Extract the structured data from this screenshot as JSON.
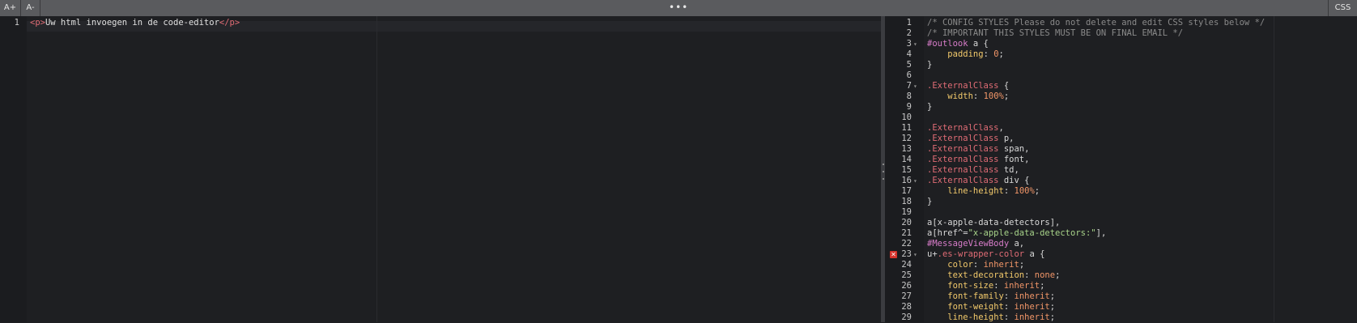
{
  "toolbar": {
    "increase_font": "A+",
    "decrease_font": "A-",
    "more": "•••",
    "css_tab": "CSS"
  },
  "html_editor": {
    "line_numbers": [
      "1"
    ],
    "lines": [
      [
        {
          "t": "tag",
          "v": "<p>"
        },
        {
          "t": "text",
          "v": "Uw html invoegen in de code-editor"
        },
        {
          "t": "tag",
          "v": "</p>"
        }
      ]
    ]
  },
  "css_editor": {
    "error_line": 23,
    "error_icon": "error-x-icon",
    "fold_lines": [
      3,
      7,
      16,
      23
    ],
    "lines": [
      [
        {
          "t": "comment",
          "v": "/* CONFIG STYLES Please do not delete and edit CSS styles below */"
        }
      ],
      [
        {
          "t": "comment",
          "v": "/* IMPORTANT THIS STYLES MUST BE ON FINAL EMAIL */"
        }
      ],
      [
        {
          "t": "hash",
          "v": "#outlook"
        },
        {
          "t": "plain",
          "v": " a {"
        }
      ],
      [
        {
          "t": "plain",
          "v": "    "
        },
        {
          "t": "prop",
          "v": "padding"
        },
        {
          "t": "punct",
          "v": ": "
        },
        {
          "t": "num",
          "v": "0"
        },
        {
          "t": "punct",
          "v": ";"
        }
      ],
      [
        {
          "t": "punct",
          "v": "}"
        }
      ],
      [],
      [
        {
          "t": "class",
          "v": ".ExternalClass"
        },
        {
          "t": "plain",
          "v": " {"
        }
      ],
      [
        {
          "t": "plain",
          "v": "    "
        },
        {
          "t": "prop",
          "v": "width"
        },
        {
          "t": "punct",
          "v": ": "
        },
        {
          "t": "num",
          "v": "100%"
        },
        {
          "t": "punct",
          "v": ";"
        }
      ],
      [
        {
          "t": "punct",
          "v": "}"
        }
      ],
      [],
      [
        {
          "t": "class",
          "v": ".ExternalClass"
        },
        {
          "t": "punct",
          "v": ","
        }
      ],
      [
        {
          "t": "class",
          "v": ".ExternalClass"
        },
        {
          "t": "plain",
          "v": " p,"
        }
      ],
      [
        {
          "t": "class",
          "v": ".ExternalClass"
        },
        {
          "t": "plain",
          "v": " span,"
        }
      ],
      [
        {
          "t": "class",
          "v": ".ExternalClass"
        },
        {
          "t": "plain",
          "v": " font,"
        }
      ],
      [
        {
          "t": "class",
          "v": ".ExternalClass"
        },
        {
          "t": "plain",
          "v": " td,"
        }
      ],
      [
        {
          "t": "class",
          "v": ".ExternalClass"
        },
        {
          "t": "plain",
          "v": " div {"
        }
      ],
      [
        {
          "t": "plain",
          "v": "    "
        },
        {
          "t": "prop",
          "v": "line-height"
        },
        {
          "t": "punct",
          "v": ": "
        },
        {
          "t": "num",
          "v": "100%"
        },
        {
          "t": "punct",
          "v": ";"
        }
      ],
      [
        {
          "t": "punct",
          "v": "}"
        }
      ],
      [],
      [
        {
          "t": "plain",
          "v": "a[x-apple-data-detectors],"
        }
      ],
      [
        {
          "t": "plain",
          "v": "a[href^="
        },
        {
          "t": "str",
          "v": "\"x-apple-data-detectors:\""
        },
        {
          "t": "plain",
          "v": "],"
        }
      ],
      [
        {
          "t": "hash",
          "v": "#MessageViewBody"
        },
        {
          "t": "plain",
          "v": " a,"
        }
      ],
      [
        {
          "t": "plain",
          "v": "u+"
        },
        {
          "t": "class",
          "v": ".es-wrapper-color"
        },
        {
          "t": "plain",
          "v": " a {"
        }
      ],
      [
        {
          "t": "plain",
          "v": "    "
        },
        {
          "t": "prop",
          "v": "color"
        },
        {
          "t": "punct",
          "v": ": "
        },
        {
          "t": "val",
          "v": "inherit"
        },
        {
          "t": "punct",
          "v": ";"
        }
      ],
      [
        {
          "t": "plain",
          "v": "    "
        },
        {
          "t": "prop",
          "v": "text-decoration"
        },
        {
          "t": "punct",
          "v": ": "
        },
        {
          "t": "val",
          "v": "none"
        },
        {
          "t": "punct",
          "v": ";"
        }
      ],
      [
        {
          "t": "plain",
          "v": "    "
        },
        {
          "t": "prop",
          "v": "font-size"
        },
        {
          "t": "punct",
          "v": ": "
        },
        {
          "t": "val",
          "v": "inherit"
        },
        {
          "t": "punct",
          "v": ";"
        }
      ],
      [
        {
          "t": "plain",
          "v": "    "
        },
        {
          "t": "prop",
          "v": "font-family"
        },
        {
          "t": "punct",
          "v": ": "
        },
        {
          "t": "val",
          "v": "inherit"
        },
        {
          "t": "punct",
          "v": ";"
        }
      ],
      [
        {
          "t": "plain",
          "v": "    "
        },
        {
          "t": "prop",
          "v": "font-weight"
        },
        {
          "t": "punct",
          "v": ": "
        },
        {
          "t": "val",
          "v": "inherit"
        },
        {
          "t": "punct",
          "v": ";"
        }
      ],
      [
        {
          "t": "plain",
          "v": "    "
        },
        {
          "t": "prop",
          "v": "line-height"
        },
        {
          "t": "punct",
          "v": ": "
        },
        {
          "t": "val",
          "v": "inherit"
        },
        {
          "t": "punct",
          "v": ";"
        }
      ]
    ]
  }
}
